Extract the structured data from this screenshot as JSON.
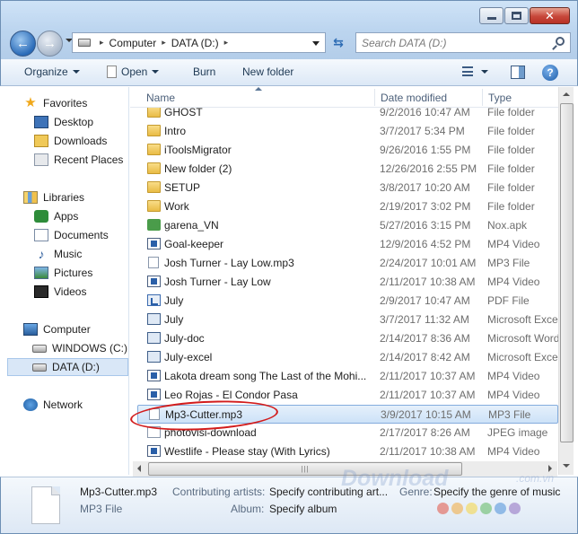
{
  "address": {
    "crumbs": [
      "Computer",
      "DATA (D:)"
    ]
  },
  "search": {
    "placeholder": "Search DATA (D:)"
  },
  "toolbar": {
    "organize": "Organize",
    "open": "Open",
    "burn": "Burn",
    "new_folder": "New folder"
  },
  "navpane": {
    "favorites": {
      "label": "Favorites",
      "items": [
        "Desktop",
        "Downloads",
        "Recent Places"
      ]
    },
    "libraries": {
      "label": "Libraries",
      "items": [
        "Apps",
        "Documents",
        "Music",
        "Pictures",
        "Videos"
      ]
    },
    "computer": {
      "label": "Computer",
      "items": [
        "WINDOWS (C:)",
        "DATA (D:)"
      ]
    },
    "network": {
      "label": "Network"
    }
  },
  "columns": {
    "name": "Name",
    "date": "Date modified",
    "type": "Type"
  },
  "files": [
    {
      "name": "GHOST",
      "date": "9/2/2016 10:47 AM",
      "type": "File folder",
      "icon": "folder"
    },
    {
      "name": "Intro",
      "date": "3/7/2017 5:34 PM",
      "type": "File folder",
      "icon": "folder"
    },
    {
      "name": "iToolsMigrator",
      "date": "9/26/2016 1:55 PM",
      "type": "File folder",
      "icon": "folder"
    },
    {
      "name": "New folder (2)",
      "date": "12/26/2016 2:55 PM",
      "type": "File folder",
      "icon": "folder"
    },
    {
      "name": "SETUP",
      "date": "3/8/2017 10:20 AM",
      "type": "File folder",
      "icon": "folder"
    },
    {
      "name": "Work",
      "date": "2/19/2017 3:02 PM",
      "type": "File folder",
      "icon": "folder"
    },
    {
      "name": "garena_VN",
      "date": "5/27/2016 3:15 PM",
      "type": "Nox.apk",
      "icon": "apk"
    },
    {
      "name": "Goal-keeper",
      "date": "12/9/2016 4:52 PM",
      "type": "MP4 Video",
      "icon": "media"
    },
    {
      "name": "Josh Turner - Lay Low.mp3",
      "date": "2/24/2017 10:01 AM",
      "type": "MP3 File",
      "icon": "file"
    },
    {
      "name": "Josh Turner - Lay Low",
      "date": "2/11/2017 10:38 AM",
      "type": "MP4 Video",
      "icon": "media"
    },
    {
      "name": "July",
      "date": "2/9/2017 10:47 AM",
      "type": "PDF File",
      "icon": "pdf"
    },
    {
      "name": "July",
      "date": "3/7/2017 11:32 AM",
      "type": "Microsoft Excel",
      "icon": "office"
    },
    {
      "name": "July-doc",
      "date": "2/14/2017 8:36 AM",
      "type": "Microsoft Word",
      "icon": "office"
    },
    {
      "name": "July-excel",
      "date": "2/14/2017 8:42 AM",
      "type": "Microsoft Excel",
      "icon": "office"
    },
    {
      "name": "Lakota dream song The Last of the Mohi...",
      "date": "2/11/2017 10:37 AM",
      "type": "MP4 Video",
      "icon": "media"
    },
    {
      "name": "Leo Rojas - El Condor Pasa",
      "date": "2/11/2017 10:37 AM",
      "type": "MP4 Video",
      "icon": "media"
    },
    {
      "name": "Mp3-Cutter.mp3",
      "date": "3/9/2017 10:15 AM",
      "type": "MP3 File",
      "icon": "file",
      "selected": true
    },
    {
      "name": "photovisi-download",
      "date": "2/17/2017 8:26 AM",
      "type": "JPEG image",
      "icon": "img"
    },
    {
      "name": "Westlife - Please stay (With Lyrics)",
      "date": "2/11/2017 10:38 AM",
      "type": "MP4 Video",
      "icon": "media"
    }
  ],
  "details": {
    "filename": "Mp3-Cutter.mp3",
    "filetype": "MP3 File",
    "artists_label": "Contributing artists:",
    "artists_value": "Specify contributing art...",
    "genre_label": "Genre:",
    "genre_value": "Specify the genre of music",
    "album_label": "Album:",
    "album_value": "Specify album"
  },
  "watermark": {
    "text": "Download",
    "suffix": ".com.vn"
  },
  "colors": {
    "selection": "#cde2f8",
    "callout": "#d21c1c",
    "accent": "#2a6bb8"
  }
}
